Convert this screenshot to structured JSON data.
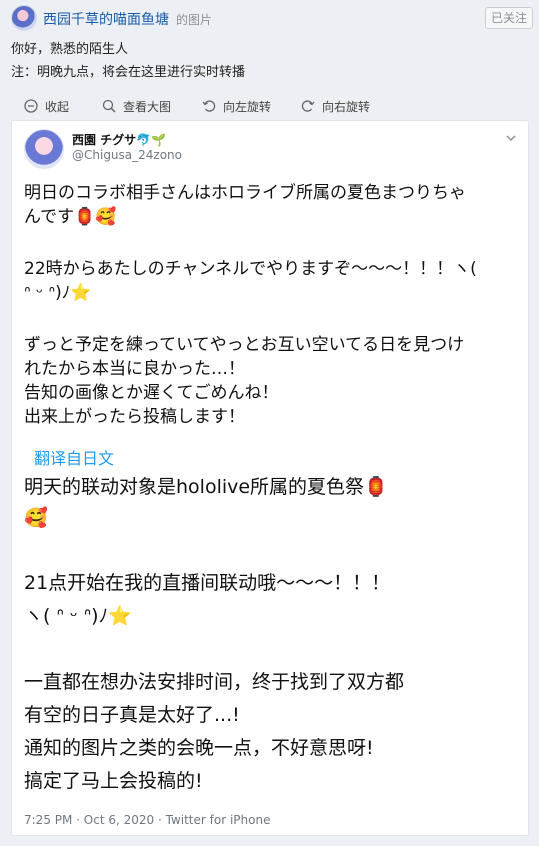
{
  "post": {
    "author": "西园千草的喵面鱼塘",
    "author_suffix": "的图片",
    "follow_label": "已关注",
    "lines": [
      "你好，熟悉的陌生人",
      "注：明晚九点，将会在这里进行实时转播"
    ]
  },
  "toolbar": {
    "collapse": "收起",
    "view_large": "查看大图",
    "rotate_left": "向左旋转",
    "rotate_right": "向右旋转"
  },
  "tweet": {
    "name": "西園 チグサ🐬🌱",
    "handle": "@Chigusa_24zono",
    "text": [
      "明日のコラボ相手さんはホロライブ所属の夏色まつりちゃ",
      "んです🏮🥰",
      "",
      "22時からあたしのチャンネルでやりますぞ〜〜〜！！！ヽ(",
      "ᐢ ᵕ ᐢ)ﾉ⭐",
      "",
      "ずっと予定を練っていてやっとお互い空いてる日を見つけ",
      "れたから本当に良かった…！",
      "告知の画像とか遅くてごめんね！",
      "出来上がったら投稿します！"
    ],
    "translate_label": "翻译自日文",
    "translation": [
      "明天的联动对象是hololive所属的夏色祭🏮",
      "🥰",
      "",
      "21点开始在我的直播间联动哦〜〜〜！！！",
      "ヽ( ᐢ ᵕ ᐢ)ﾉ⭐",
      "",
      "一直都在想办法安排时间，终于找到了双方都",
      "有空的日子真是太好了...!",
      "通知的图片之类的会晚一点，不好意思呀!",
      "搞定了马上会投稿的!"
    ],
    "footer": "7:25 PM · Oct 6, 2020 · Twitter for iPhone"
  },
  "icons": {
    "collapse": "collapse-icon",
    "view_large": "magnifier-icon",
    "rotate_left": "rotate-left-icon",
    "rotate_right": "rotate-right-icon",
    "menu": "chevron-down-icon"
  },
  "colors": {
    "link_blue": "#1a5aa8",
    "twitter_blue": "#1d9bf0"
  }
}
